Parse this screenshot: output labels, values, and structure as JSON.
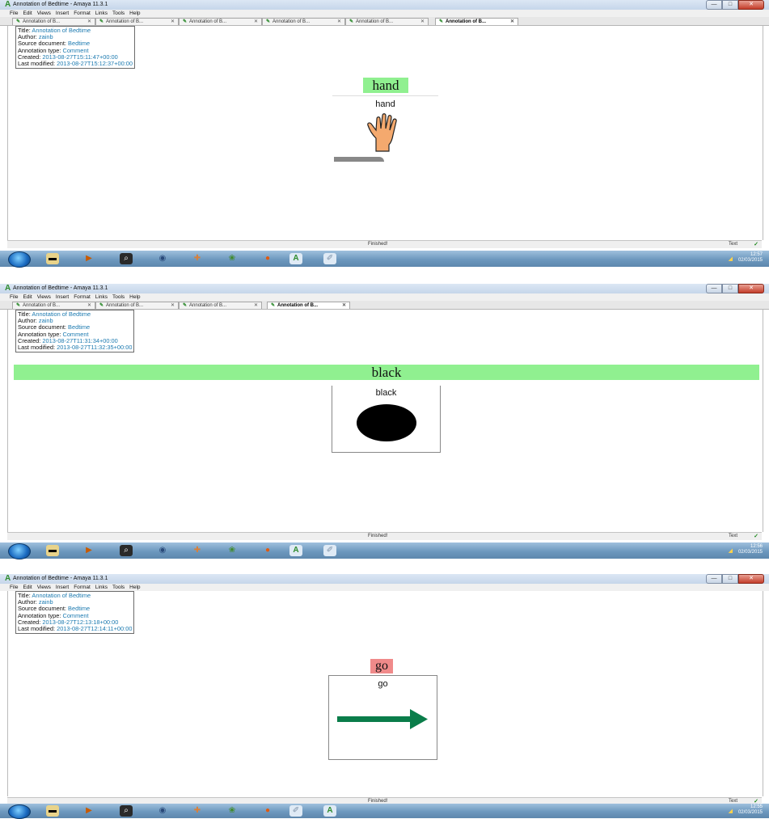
{
  "window": {
    "app_icon": "amaya-icon",
    "title": "Annotation of Bedtime - Amaya 11.3.1",
    "menu": [
      "File",
      "Edit",
      "Views",
      "Insert",
      "Format",
      "Links",
      "Tools",
      "Help"
    ],
    "controls": {
      "minimize": "—",
      "maximize": "□",
      "close": "✕"
    }
  },
  "meta_labels": {
    "title": "Title:",
    "author": "Author:",
    "source": "Source document:",
    "type": "Annotation type:",
    "created": "Created:",
    "modified": "Last modified:"
  },
  "screens": [
    {
      "tabs": [
        {
          "label": "Annotation of B...",
          "active": false
        },
        {
          "label": "Annotation of B...",
          "active": false
        },
        {
          "label": "Annotation of B...",
          "active": false
        },
        {
          "label": "Annotation of B...",
          "active": false
        },
        {
          "label": "Annotation of B...",
          "active": false
        },
        {
          "label": "Annotation of B...",
          "active": true
        }
      ],
      "meta": {
        "title": "Annotation of Bedtime",
        "author": "zainb",
        "source": "Bedtime",
        "type": "Comment",
        "created": "2013-08-27T15:11:47+00:00",
        "modified": "2013-08-27T15:12:37+00:00"
      },
      "heading": "hand",
      "heading_bg": "#90f090",
      "symbol_label": "hand",
      "symbol_icon": "hand-icon",
      "status": "Finished!",
      "mode": "Text",
      "clock": {
        "time": "12:57",
        "date": "02/03/2015"
      }
    },
    {
      "tabs": [
        {
          "label": "Annotation of B...",
          "active": false
        },
        {
          "label": "Annotation of B...",
          "active": false
        },
        {
          "label": "Annotation of B...",
          "active": false
        },
        {
          "label": "Annotation of B...",
          "active": true
        }
      ],
      "meta": {
        "title": "Annotation of Bedtime",
        "author": "zainb",
        "source": "Bedtime",
        "type": "Comment",
        "created": "2013-08-27T11:31:34+00:00",
        "modified": "2013-08-27T11:32:35+00:00"
      },
      "heading": "black",
      "heading_bg": "#90f090",
      "symbol_label": "black",
      "symbol_icon": "black-circle-icon",
      "status": "Finished!",
      "mode": "Text",
      "clock": {
        "time": "12:56",
        "date": "02/03/2015"
      }
    },
    {
      "tabs": [],
      "meta": {
        "title": "Annotation of Bedtime",
        "author": "zainb",
        "source": "Bedtime",
        "type": "Comment",
        "created": "2013-08-27T12:13:18+00:00",
        "modified": "2013-08-27T12:14:11+00:00"
      },
      "heading": "go",
      "heading_bg": "#f08a8a",
      "symbol_label": "go",
      "symbol_icon": "right-arrow-icon",
      "status": "Finished!",
      "mode": "Text",
      "clock": {
        "time": "12:55",
        "date": "02/03/2015"
      }
    }
  ],
  "taskbar": {
    "items": [
      "start-button",
      "explorer-icon",
      "media-player-icon",
      "search-icon",
      "network-icon",
      "app-icon",
      "game-icon",
      "firefox-icon",
      "amaya-icon",
      "paint-icon"
    ]
  }
}
